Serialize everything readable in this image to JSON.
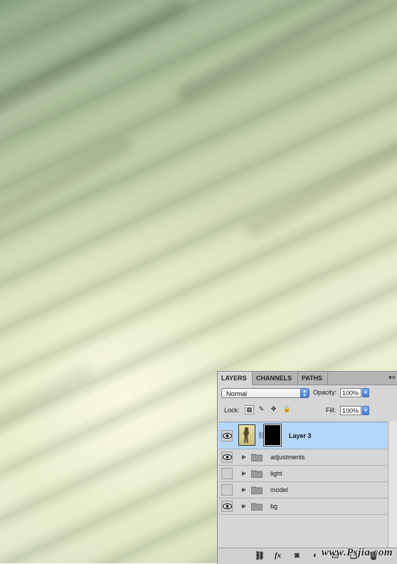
{
  "panel": {
    "tabs": [
      {
        "label": "LAYERS",
        "active": true
      },
      {
        "label": "CHANNELS",
        "active": false
      },
      {
        "label": "PATHS",
        "active": false
      }
    ],
    "menu_icon": "panel-menu-icon"
  },
  "blend": {
    "mode": "Normal",
    "opacity_label": "Opacity:",
    "opacity_value": "100%"
  },
  "lock": {
    "label": "Lock:",
    "fill_label": "Fill:",
    "fill_value": "100%",
    "icons": [
      "lock-transparent-icon",
      "lock-image-icon",
      "lock-position-icon",
      "lock-all-icon"
    ]
  },
  "layers": [
    {
      "name": "Layer 3",
      "type": "layer",
      "visible": true,
      "selected": true
    },
    {
      "name": "adjustments",
      "type": "group",
      "visible": true,
      "selected": false
    },
    {
      "name": "light",
      "type": "group",
      "visible": false,
      "selected": false
    },
    {
      "name": "model",
      "type": "group",
      "visible": false,
      "selected": false
    },
    {
      "name": "bg",
      "type": "group",
      "visible": true,
      "selected": false
    }
  ],
  "bottom_bar": {
    "icons": [
      "link-layers-icon",
      "fx-icon",
      "add-mask-icon",
      "adjustment-icon",
      "new-group-icon",
      "new-layer-icon",
      "delete-icon"
    ],
    "fx_label": "fx"
  },
  "watermark": "www.Psjia.com",
  "colors": {
    "selected_row": "#b5d6fb",
    "panel_bg": "#d6d6d6",
    "accent_blue": "#3a7fdd"
  }
}
